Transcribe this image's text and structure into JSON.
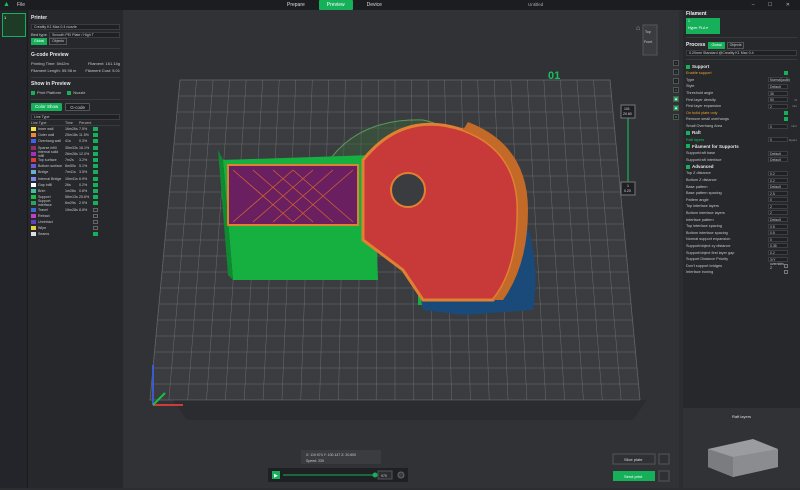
{
  "topbar": {
    "menu": "File",
    "tabs": [
      "Prepare",
      "Preview",
      "Device"
    ],
    "active_tab": 1,
    "window_title": "Untitled",
    "controls": "– ☐ ✕"
  },
  "thumbnail": {
    "index": "1"
  },
  "printer": {
    "title": "Printer",
    "name": "Creality K1 Max 0.4 nozzle",
    "bed_type_label": "Bed type",
    "bed_type_value": "Smooth PEI Plate / High T",
    "tab_global": "Global",
    "tab_objects": "Objects"
  },
  "gcode_preview": {
    "title": "G-code Preview",
    "printing_time": "Printing Time: 5h42m",
    "filament_weight": "Filament: 161.14g",
    "filament_length": "Filament Length: 55.98 m",
    "filament_cost": "Filament Cost: 5.01"
  },
  "show_in_preview": {
    "title": "Show in Preview",
    "print_platform": "Print Platform",
    "nozzle": "Nozzle"
  },
  "view_buttons": {
    "color_show": "Color Show",
    "gcode": "G-code"
  },
  "line_type": {
    "dropdown": "Line Type",
    "headers": [
      "Line Type",
      "Time",
      "Percent"
    ],
    "rows": [
      {
        "name": "Inner wall",
        "time": "16m26s",
        "pct": "7.5%",
        "color": "#f5e04a",
        "on": true
      },
      {
        "name": "Outer wall",
        "time": "25m18s",
        "pct": "11.5%",
        "color": "#f08a2a",
        "on": true
      },
      {
        "name": "Overhang wall",
        "time": "41s",
        "pct": "0.3%",
        "color": "#4060f0",
        "on": true
      },
      {
        "name": "Sparse infill",
        "time": "35m33s",
        "pct": "16.1%",
        "color": "#9a2a6a",
        "on": true
      },
      {
        "name": "Internal solid infill",
        "time": "26m28s",
        "pct": "12.0%",
        "color": "#a030c0",
        "on": true
      },
      {
        "name": "Top surface",
        "time": "7m2s",
        "pct": "3.2%",
        "color": "#e03a3a",
        "on": true
      },
      {
        "name": "Bottom surface",
        "time": "8m50s",
        "pct": "5.1%",
        "color": "#6a5acd",
        "on": true
      },
      {
        "name": "Bridge",
        "time": "7m41s",
        "pct": "3.5%",
        "color": "#6ab0d0",
        "on": true
      },
      {
        "name": "Internal Bridge",
        "time": "15m41s",
        "pct": "6.9%",
        "color": "#7a8af0",
        "on": true
      },
      {
        "name": "Gap infill",
        "time": "26s",
        "pct": "0.2%",
        "color": "#ffffff",
        "on": true
      },
      {
        "name": "Brim",
        "time": "1m26s",
        "pct": "0.6%",
        "color": "#40c0a0",
        "on": true
      },
      {
        "name": "Support",
        "time": "56m13s",
        "pct": "25.6%",
        "color": "#16c040",
        "on": true
      },
      {
        "name": "Support interface",
        "time": "6m29s",
        "pct": "2.9%",
        "color": "#30a060",
        "on": true
      },
      {
        "name": "Travel",
        "time": "19m28s",
        "pct": "8.8%",
        "color": "#3a6ad0",
        "on": false
      },
      {
        "name": "Retract",
        "time": "",
        "pct": "",
        "color": "#c040c0",
        "on": false
      },
      {
        "name": "Unretract",
        "time": "",
        "pct": "",
        "color": "#6040c0",
        "on": false
      },
      {
        "name": "Wipe",
        "time": "",
        "pct": "",
        "color": "#e0d040",
        "on": false
      },
      {
        "name": "Seams",
        "time": "",
        "pct": "",
        "color": "#e0e0e0",
        "on": true
      }
    ]
  },
  "viewport": {
    "plate_label": "01",
    "layer_top": "101",
    "layer_top_z": "20.60",
    "layer_bottom": "1",
    "layer_bottom_z": "0.20",
    "view_top": "Top",
    "view_front": "Front",
    "coords": "X: 119.974  Y: 100.147  Z: 20.600",
    "speed": "Speed: 239",
    "slider_value": "970",
    "slice_button": "Slice plate",
    "send_button": "Send print",
    "raft_layers_preview": "Raft layers"
  },
  "filament": {
    "title": "Filament",
    "slot": "1",
    "name": "Hyper PLA ▾"
  },
  "process": {
    "title": "Process",
    "tab_global": "Global",
    "tab_objects": "Objects",
    "profile": "0.20mm Standard @Creality K1 Max 0.4",
    "support_group": "Support",
    "enable_support": "Enable support",
    "type_label": "Type",
    "type_value": "Normal(auto)",
    "style_label": "Style",
    "style_value": "Default",
    "threshold_label": "Threshold angle",
    "threshold_value": "30",
    "first_density_label": "First layer density",
    "first_density_value": "90",
    "first_density_unit": "%",
    "first_expansion_label": "First layer expansion",
    "first_expansion_value": "2",
    "first_expansion_unit": "mm",
    "on_build_plate": "On build plate only",
    "remove_small": "Remove small overhangs",
    "small_area_label": "Small Overhang Area",
    "small_area_value": "0",
    "small_area_unit": "mm²",
    "raft_group": "Raft",
    "raft_layers_label": "Raft layers",
    "raft_layers_value": "0",
    "raft_layers_unit": "layers",
    "filament_support_group": "Filament for Supports",
    "support_base_label": "Support/raft base",
    "support_base_value": "Default",
    "support_interface_label": "Support/raft interface",
    "support_interface_value": "Default",
    "advanced_group": "Advanced",
    "top_z_label": "Top Z distance",
    "top_z_value": "0.2",
    "bottom_z_label": "Bottom Z distance",
    "bottom_z_value": "0.2",
    "base_pattern_label": "Base pattern",
    "base_pattern_value": "Default",
    "base_spacing_label": "Base pattern spacing",
    "base_spacing_value": "2.5",
    "pattern_angle_label": "Pattern angle",
    "pattern_angle_value": "0",
    "top_iface_layers_label": "Top interface layers",
    "top_iface_layers_value": "2",
    "bottom_iface_layers_label": "Bottom interface layers",
    "bottom_iface_layers_value": "2",
    "iface_pattern_label": "Interface pattern",
    "iface_pattern_value": "Default",
    "top_iface_spacing_label": "Top interface spacing",
    "top_iface_spacing_value": "0.5",
    "bottom_iface_spacing_label": "Bottom interface spacing",
    "bottom_iface_spacing_value": "0.5",
    "normal_expansion_label": "Normal support expansion",
    "normal_expansion_value": "0",
    "obj_xy_label": "Support/object xy distance",
    "obj_xy_value": "0.35",
    "obj_first_layer_label": "Support/object first layer gap",
    "obj_first_layer_value": "0.2",
    "priority_label": "Support Distance Priority",
    "priority_value": "X/Y overrides Z",
    "no_bridges_label": "Don't support bridges",
    "iface_ironing_label": "Interface ironing"
  },
  "colors": {
    "accent": "#16b05a",
    "warn": "#f0a030"
  }
}
